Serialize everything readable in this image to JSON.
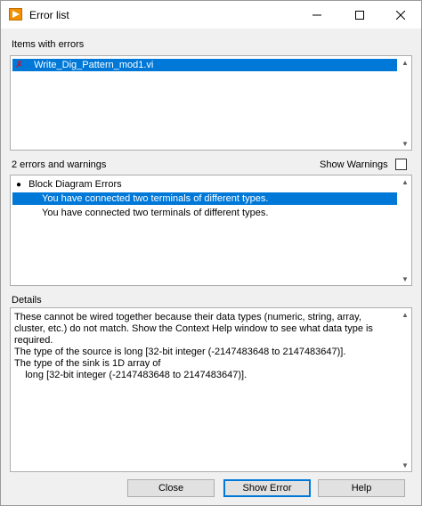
{
  "window": {
    "title": "Error list"
  },
  "items_section": {
    "label": "Items with errors",
    "items": [
      {
        "label": "Write_Dig_Pattern_mod1.vi",
        "selected": true,
        "icon": "error-x-icon"
      }
    ]
  },
  "errors_section": {
    "count_label": "2 errors and warnings",
    "show_warnings_label": "Show Warnings",
    "show_warnings_checked": false,
    "group_label": "Block Diagram Errors",
    "errors": [
      {
        "label": "You have connected two terminals of different types.",
        "selected": true
      },
      {
        "label": "You have connected two terminals of different types.",
        "selected": false
      }
    ]
  },
  "details_section": {
    "label": "Details",
    "text": "These cannot be wired together because their data types (numeric, string, array,\ncluster, etc.) do not match. Show the Context Help window to see what data type is\nrequired.\nThe type of the source is long [32-bit integer (-2147483648 to 2147483647)].\nThe type of the sink is 1D array of\n    long [32-bit integer (-2147483648 to 2147483647)]."
  },
  "buttons": {
    "close": "Close",
    "show_error": "Show Error",
    "help": "Help"
  },
  "colors": {
    "selection": "#0078d7",
    "error_icon": "#c8102e",
    "app_icon": "#f29100"
  }
}
